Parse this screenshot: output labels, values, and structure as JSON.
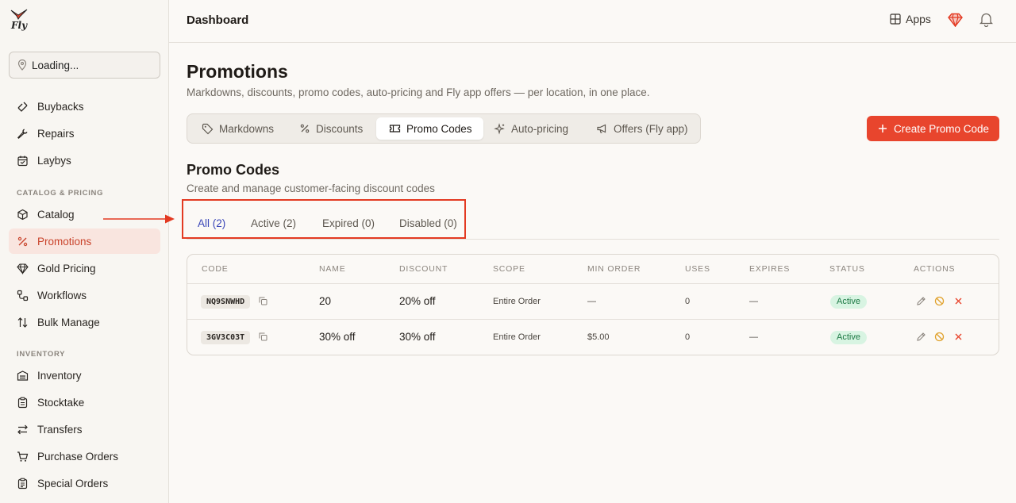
{
  "brand": {
    "logo_text": "Fly"
  },
  "sidebar": {
    "location": "Loading...",
    "items_top": [
      {
        "label": "Buybacks",
        "icon": "buyback-icon"
      },
      {
        "label": "Repairs",
        "icon": "wrench-icon"
      },
      {
        "label": "Laybys",
        "icon": "calendar-icon"
      }
    ],
    "section_catalog": "CATALOG & PRICING",
    "items_catalog": [
      {
        "label": "Catalog",
        "icon": "box-icon"
      },
      {
        "label": "Promotions",
        "icon": "percent-icon",
        "active": true
      },
      {
        "label": "Gold Pricing",
        "icon": "gem-icon"
      },
      {
        "label": "Workflows",
        "icon": "workflow-icon"
      },
      {
        "label": "Bulk Manage",
        "icon": "sort-arrows-icon"
      }
    ],
    "section_inventory": "INVENTORY",
    "items_inventory": [
      {
        "label": "Inventory",
        "icon": "inventory-icon"
      },
      {
        "label": "Stocktake",
        "icon": "clipboard-icon"
      },
      {
        "label": "Transfers",
        "icon": "transfer-icon"
      },
      {
        "label": "Purchase Orders",
        "icon": "cart-icon"
      },
      {
        "label": "Special Orders",
        "icon": "clipboard-list-icon"
      }
    ]
  },
  "topbar": {
    "title": "Dashboard",
    "apps_label": "Apps"
  },
  "page": {
    "title": "Promotions",
    "subtitle": "Markdowns, discounts, promo codes, auto-pricing and Fly app offers — per location, in one place.",
    "tabs": [
      {
        "label": "Markdowns",
        "icon": "tag-icon"
      },
      {
        "label": "Discounts",
        "icon": "percent-icon"
      },
      {
        "label": "Promo Codes",
        "icon": "ticket-icon",
        "active": true
      },
      {
        "label": "Auto-pricing",
        "icon": "sparkle-icon"
      },
      {
        "label": "Offers (Fly app)",
        "icon": "megaphone-icon"
      }
    ],
    "create_button": "Create Promo Code"
  },
  "promo": {
    "title": "Promo Codes",
    "subtitle": "Create and manage customer-facing discount codes",
    "filters": [
      {
        "label": "All (2)",
        "active": true
      },
      {
        "label": "Active (2)"
      },
      {
        "label": "Expired (0)"
      },
      {
        "label": "Disabled (0)"
      }
    ],
    "columns": [
      "CODE",
      "NAME",
      "DISCOUNT",
      "SCOPE",
      "MIN ORDER",
      "USES",
      "EXPIRES",
      "STATUS",
      "ACTIONS"
    ],
    "rows": [
      {
        "code": "NQ9SNWHD",
        "name": "20",
        "discount": "20% off",
        "scope": "Entire Order",
        "min_order": "—",
        "uses": "0",
        "expires": "—",
        "status": "Active"
      },
      {
        "code": "3GV3C03T",
        "name": "30% off",
        "discount": "30% off",
        "scope": "Entire Order",
        "min_order": "$5.00",
        "uses": "0",
        "expires": "—",
        "status": "Active"
      }
    ]
  },
  "colors": {
    "accent": "#e8452d",
    "active_nav_bg": "#f9e5df",
    "status_green": "#1e7a45",
    "link_blue": "#3a46b8"
  }
}
